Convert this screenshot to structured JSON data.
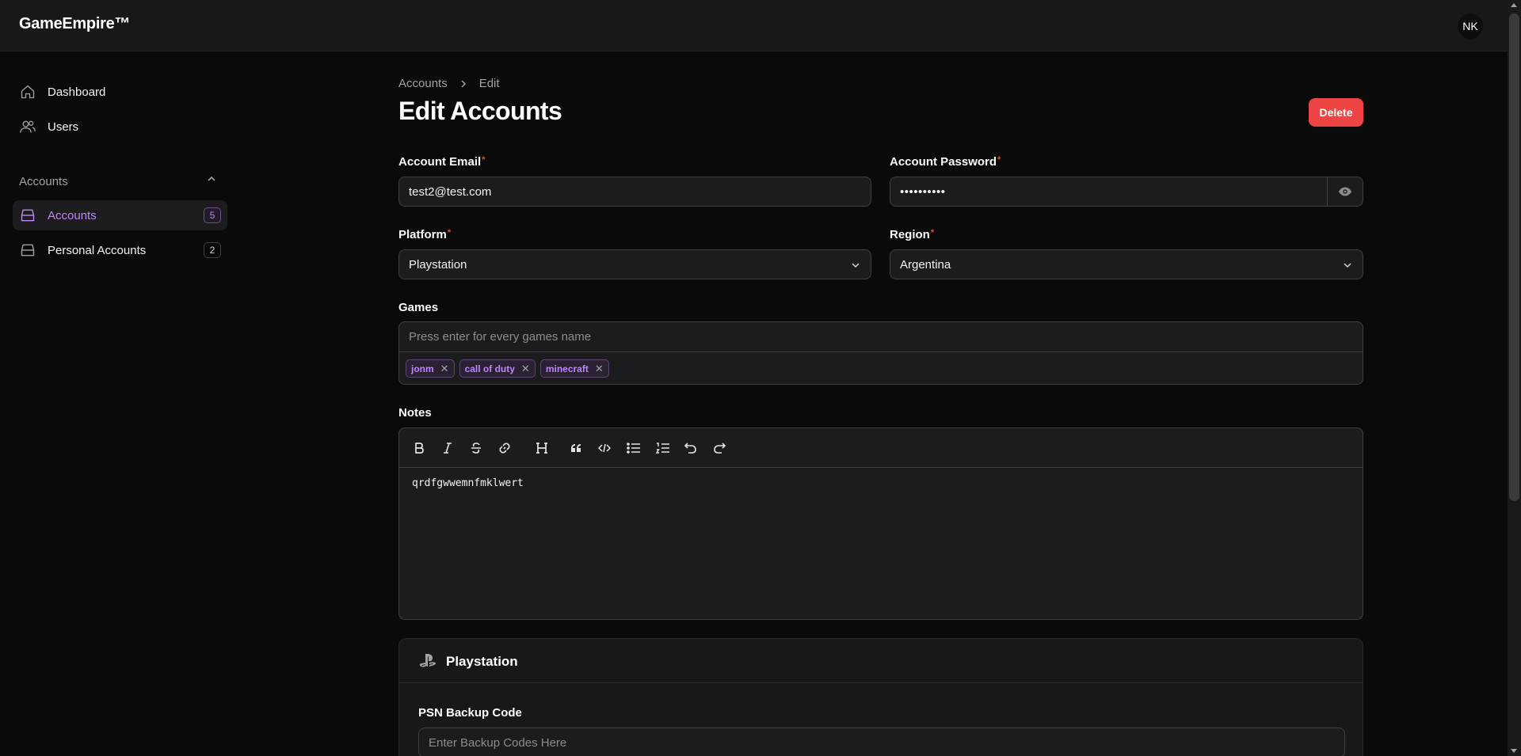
{
  "app": {
    "brand": "GameEmpire™",
    "avatar_initials": "NK"
  },
  "sidebar": {
    "items": [
      {
        "label": "Dashboard",
        "icon": "home-icon"
      },
      {
        "label": "Users",
        "icon": "users-icon"
      }
    ],
    "group": {
      "label": "Accounts",
      "items": [
        {
          "label": "Accounts",
          "badge": "5",
          "active": true,
          "icon": "inbox-icon"
        },
        {
          "label": "Personal Accounts",
          "badge": "2",
          "active": false,
          "icon": "inbox-icon"
        }
      ]
    }
  },
  "breadcrumb": {
    "parent": "Accounts",
    "current": "Edit"
  },
  "page": {
    "title": "Edit Accounts",
    "delete_label": "Delete"
  },
  "form": {
    "email": {
      "label": "Account Email",
      "value": "test2@test.com"
    },
    "password": {
      "label": "Account Password",
      "value": "••••••••••"
    },
    "platform": {
      "label": "Platform",
      "value": "Playstation"
    },
    "region": {
      "label": "Region",
      "value": "Argentina"
    },
    "games": {
      "label": "Games",
      "placeholder": "Press enter for every games name",
      "tags": [
        "jonm",
        "call of duty",
        "minecraft"
      ]
    },
    "notes": {
      "label": "Notes",
      "value": "qrdfgwwemnfmklwert"
    },
    "playstation_section": {
      "title": "Playstation",
      "psn_label": "PSN Backup Code",
      "psn_placeholder": "Enter Backup Codes Here"
    }
  },
  "colors": {
    "accent": "#c084fc",
    "danger": "#ef4444",
    "background": "#0a0a0b"
  }
}
